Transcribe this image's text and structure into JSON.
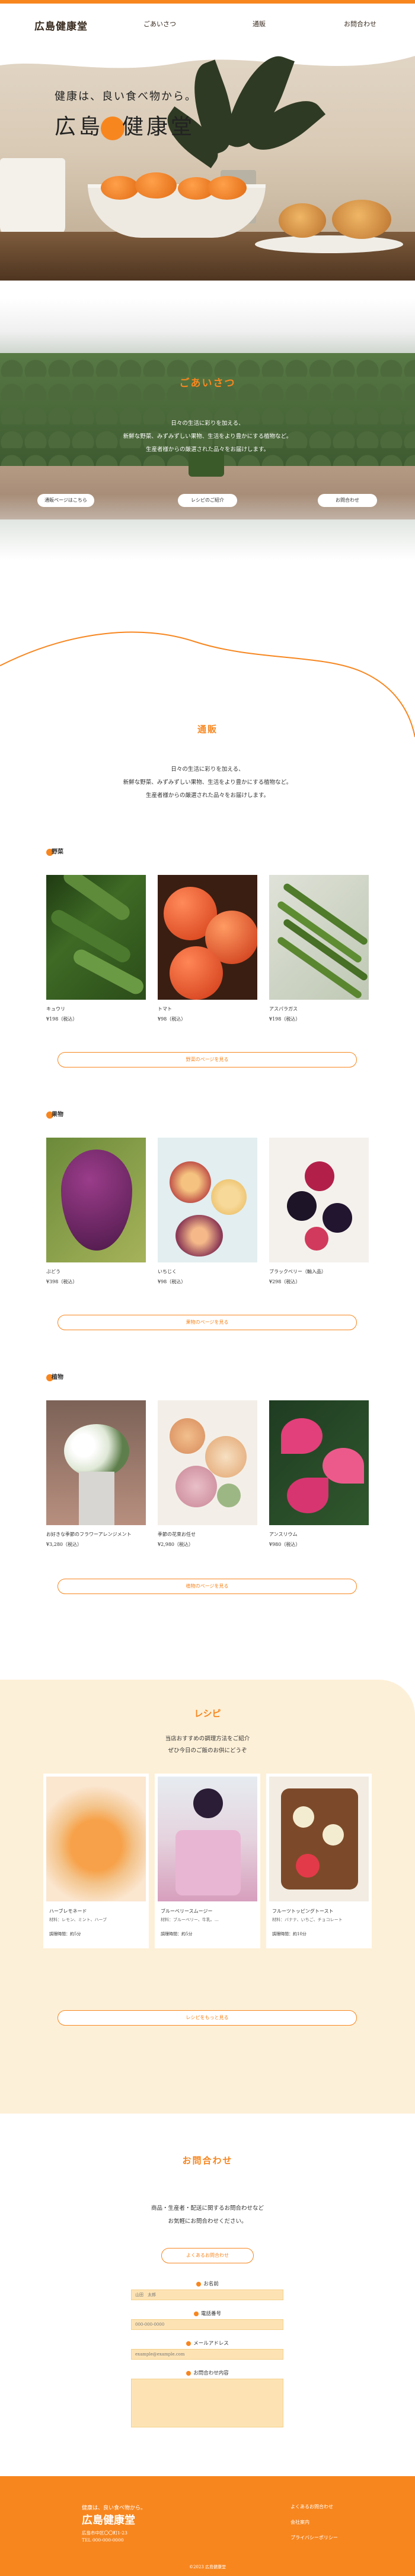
{
  "header": {
    "logo": "広島健康堂",
    "nav": [
      "ごあいさつ",
      "通販",
      "お問合わせ"
    ]
  },
  "hero": {
    "subtitle": "健康は、良い食べ物から。",
    "title_left": "広島",
    "title_right": "健康堂"
  },
  "greeting": {
    "title": "ごあいさつ",
    "lines": [
      "日々の生活に彩りを加える、",
      "新鮮な野菜、みずみずしい果物、生活をより豊かにする植物など。",
      "生産者様からの厳選された品々をお届けします。"
    ],
    "buttons": [
      "通販ページはこちら",
      "レシピのご紹介",
      "お問合わせ"
    ]
  },
  "intro": {
    "title": "通販",
    "lines": [
      "日々の生活に彩りを加える、",
      "新鮮な野菜、みずみずしい果物、生活をより豊かにする植物など。",
      "生産者様からの厳選された品々をお届けします。"
    ]
  },
  "categories": [
    {
      "title": "野菜",
      "more": "野菜のページを見る",
      "items": [
        {
          "name": "キュウリ",
          "price": "¥198（税込）"
        },
        {
          "name": "トマト",
          "price": "¥98（税込）"
        },
        {
          "name": "アスパラガス",
          "price": "¥198（税込）"
        }
      ]
    },
    {
      "title": "果物",
      "more": "果物のページを見る",
      "items": [
        {
          "name": "ぶどう",
          "price": "¥398（税込）"
        },
        {
          "name": "いちじく",
          "price": "¥98（税込）"
        },
        {
          "name": "ブラックベリー（輸入品）",
          "price": "¥298（税込）"
        }
      ]
    },
    {
      "title": "植物",
      "more": "植物のページを見る",
      "items": [
        {
          "name": "お好きな季節のフラワーアレンジメント",
          "price": "¥3,280（税込）"
        },
        {
          "name": "季節の花束お任せ",
          "price": "¥2,980（税込）"
        },
        {
          "name": "アンスリウム",
          "price": "¥980（税込）"
        }
      ]
    }
  ],
  "recipe": {
    "title": "レシピ",
    "lines": [
      "当店おすすめの調理方法をご紹介",
      "ぜひ今日のご飯のお供にどうぞ"
    ],
    "items": [
      {
        "name": "ハーブレモネード",
        "ingredients": "材料：レモン、ミント、ハーブ",
        "time": "調理時間：約5分"
      },
      {
        "name": "ブルーベリースムージー",
        "ingredients": "材料：ブルーベリー、牛乳、…",
        "time": "調理時間：約5分"
      },
      {
        "name": "フルーツトッピングトースト",
        "ingredients": "材料：バナナ、いちご、チョコレート",
        "time": "調理時間：約10分"
      }
    ],
    "more": "レシピをもっと見る"
  },
  "contact": {
    "title": "お問合わせ",
    "lines": [
      "商品・生産者・配送に関するお問合わせなど",
      "お気軽にお問合わせください。"
    ],
    "faq": "よくあるお問合わせ",
    "fields": [
      {
        "label": "お名前",
        "placeholder": "山田　太郎"
      },
      {
        "label": "電話番号",
        "placeholder": "000-000-0000"
      },
      {
        "label": "メールアドレス",
        "placeholder": "example@example.com"
      },
      {
        "label": "お問合わせ内容",
        "placeholder": ""
      }
    ]
  },
  "footer": {
    "tagline": "健康は、良い食べ物から。",
    "logo": "広島健康堂",
    "address": [
      "広島市中区〇〇町1-23",
      "TEL 000-000-0000"
    ],
    "links": [
      "よくあるお問合わせ",
      "会社案内",
      "プライバシーポリシー"
    ],
    "copyright": "©2023 広島健康堂"
  },
  "colors": {
    "accent": "#f7861f",
    "recipe_bg": "#fdf0d8",
    "input_bg": "#fde3b4"
  }
}
